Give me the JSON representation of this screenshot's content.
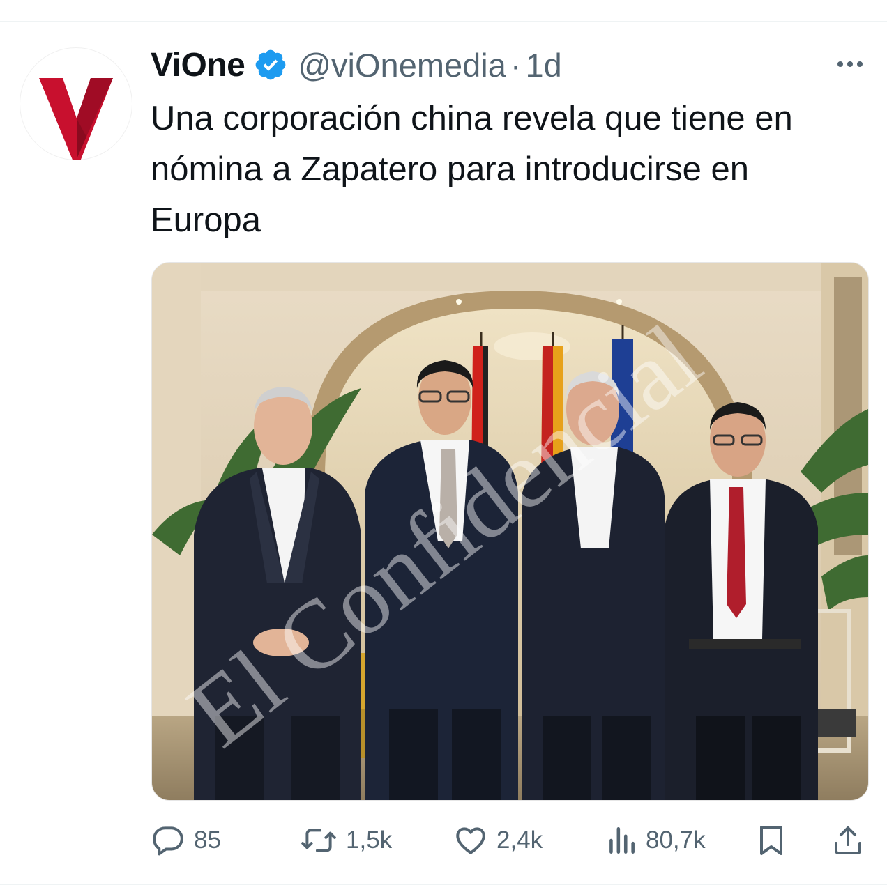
{
  "tweet": {
    "author": {
      "display_name": "ViOne",
      "handle": "@viOnemedia",
      "verified": true
    },
    "separator": "·",
    "timestamp": "1d",
    "text": "Una corporación china revela que tiene en nómina a Zapatero para introducirse en Europa",
    "media": {
      "watermark": "El Confidencial"
    }
  },
  "actions": {
    "replies": "85",
    "reposts": "1,5k",
    "likes": "2,4k",
    "views": "80,7k"
  },
  "icons": {
    "more": "more-horizontal-icon",
    "reply": "speech-bubble-icon",
    "repost": "repost-arrows-icon",
    "like": "heart-icon",
    "views": "bar-chart-icon",
    "bookmark": "bookmark-icon",
    "share": "share-upload-icon"
  },
  "colors": {
    "brand_red": "#c8102e",
    "verified_blue": "#1d9bf0",
    "secondary_text": "#536471"
  }
}
